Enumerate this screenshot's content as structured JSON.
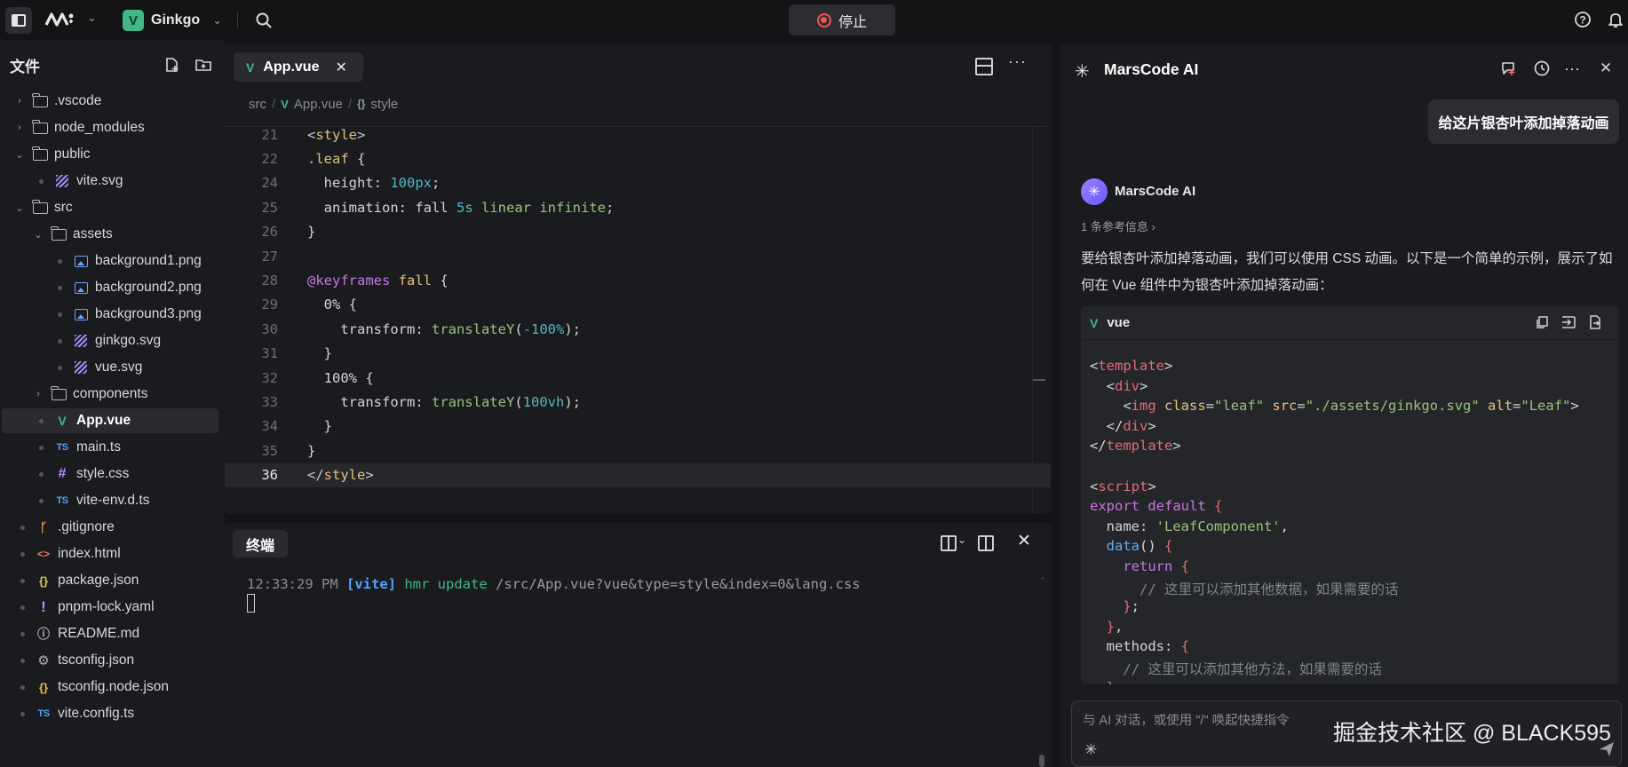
{
  "topbar": {
    "project_name": "Ginkgo",
    "stop_label": "停止"
  },
  "sidebar": {
    "title": "文件",
    "tree": [
      {
        "label": ".vscode",
        "kind": "folder",
        "depth": 0,
        "state": "collapsed"
      },
      {
        "label": "node_modules",
        "kind": "folder",
        "depth": 0,
        "state": "collapsed"
      },
      {
        "label": "public",
        "kind": "folder",
        "depth": 0,
        "state": "expanded"
      },
      {
        "label": "vite.svg",
        "kind": "svg",
        "depth": 1
      },
      {
        "label": "src",
        "kind": "folder",
        "depth": 0,
        "state": "expanded"
      },
      {
        "label": "assets",
        "kind": "folder",
        "depth": 1,
        "state": "expanded"
      },
      {
        "label": "background1.png",
        "kind": "image",
        "depth": 2
      },
      {
        "label": "background2.png",
        "kind": "image",
        "depth": 2
      },
      {
        "label": "background3.png",
        "kind": "image",
        "depth": 2
      },
      {
        "label": "ginkgo.svg",
        "kind": "svg",
        "depth": 2
      },
      {
        "label": "vue.svg",
        "kind": "svg",
        "depth": 2
      },
      {
        "label": "components",
        "kind": "folder",
        "depth": 1,
        "state": "collapsed"
      },
      {
        "label": "App.vue",
        "kind": "vue",
        "depth": 1,
        "active": true
      },
      {
        "label": "main.ts",
        "kind": "ts",
        "depth": 1
      },
      {
        "label": "style.css",
        "kind": "css",
        "depth": 1
      },
      {
        "label": "vite-env.d.ts",
        "kind": "ts",
        "depth": 1
      },
      {
        "label": ".gitignore",
        "kind": "git",
        "depth": 0
      },
      {
        "label": "index.html",
        "kind": "html",
        "depth": 0
      },
      {
        "label": "package.json",
        "kind": "json",
        "depth": 0
      },
      {
        "label": "pnpm-lock.yaml",
        "kind": "yaml",
        "depth": 0
      },
      {
        "label": "README.md",
        "kind": "info",
        "depth": 0
      },
      {
        "label": "tsconfig.json",
        "kind": "gear",
        "depth": 0
      },
      {
        "label": "tsconfig.node.json",
        "kind": "json",
        "depth": 0
      },
      {
        "label": "vite.config.ts",
        "kind": "ts",
        "depth": 0
      }
    ]
  },
  "editor": {
    "tab_label": "App.vue",
    "breadcrumb": [
      "src",
      "App.vue",
      "style"
    ],
    "current_line": "36",
    "lines": [
      {
        "n": "21",
        "html": "<span class='kw-punct'>&lt;</span><span class='kw-tag'>style</span><span class='kw-punct'>&gt;</span>"
      },
      {
        "n": "22",
        "html": "<span class='kw-tag'>.leaf</span> {"
      },
      {
        "n": "24",
        "html": "  height: <span class='kw-num'>100px</span>;"
      },
      {
        "n": "25",
        "html": "  animation: fall <span class='kw-num'>5s</span> <span class='kw-val'>linear</span> <span class='kw-val'>infinite</span>;"
      },
      {
        "n": "26",
        "html": "}"
      },
      {
        "n": "27",
        "html": ""
      },
      {
        "n": "28",
        "html": "<span class='kw-at'>@keyframes</span> <span class='kw-tag'>fall</span> {"
      },
      {
        "n": "29",
        "html": "  0% {"
      },
      {
        "n": "30",
        "html": "    transform: <span class='kw-val'>translateY</span>(<span class='kw-num'>-100%</span>);"
      },
      {
        "n": "31",
        "html": "  }"
      },
      {
        "n": "32",
        "html": "  100% {"
      },
      {
        "n": "33",
        "html": "    transform: <span class='kw-val'>translateY</span>(<span class='kw-num'>100vh</span>);"
      },
      {
        "n": "34",
        "html": "  }"
      },
      {
        "n": "35",
        "html": "}"
      },
      {
        "n": "36",
        "html": "<span class='kw-punct'>&lt;/</span><span class='kw-tag'>style</span><span class='kw-punct'>&gt;</span>"
      }
    ]
  },
  "terminal": {
    "tab_label": "终端",
    "time": "12:33:29 PM",
    "tag": "[vite]",
    "event": "hmr update",
    "path": "/src/App.vue?vue&type=style&index=0&lang.css"
  },
  "ai": {
    "title": "MarsCode AI",
    "user_message": "给这片银杏叶添加掉落动画",
    "assistant_name": "MarsCode AI",
    "refs": "1 条参考信息",
    "reply": "要给银杏叶添加掉落动画，我们可以使用 CSS 动画。以下是一个简单的示例，展示了如何在 Vue 组件中为银杏叶添加掉落动画：",
    "code_lang": "vue",
    "code_lines": [
      "<span class='t-punct'>&lt;</span><span class='t-tag'>template</span>&gt;",
      "  &lt;<span class='t-tag'>div</span>&gt;",
      "    &lt;<span class='t-tag'>img</span> <span class='t-attr'>class</span>=<span class='t-str'>\"leaf\"</span> <span class='t-attr'>src</span>=<span class='t-str'>\"./assets/ginkgo.svg\"</span> <span class='t-attr'>alt</span>=<span class='t-str'>\"Leaf\"</span>&gt;",
      "  &lt;/<span class='t-tag'>div</span>&gt;",
      "&lt;/<span class='t-tag'>template</span>&gt;",
      "",
      "&lt;<span class='t-tag'>script</span>&gt;",
      "<span class='t-kw'>export default</span> <span class='t-br'>{</span>",
      "  name: <span class='t-str'>'LeafComponent'</span>,",
      "  <span class='t-fn'>data</span>() <span class='t-br'>{</span>",
      "    <span class='t-kw'>return</span> <span class='t-br'>{</span>",
      "      <span class='t-com'>// 这里可以添加其他数据，如果需要的话</span>",
      "    <span class='t-br'>}</span>;",
      "  <span class='t-br'>}</span>,",
      "  methods: <span class='t-br'>{</span>",
      "    <span class='t-com'>// 这里可以添加其他方法，如果需要的话</span>",
      "  <span class='t-br'>}</span>"
    ],
    "input_placeholder": "与 AI 对话，或使用 \"/\" 唤起快捷指令"
  },
  "watermark": "掘金技术社区 @ BLACK595",
  "colors": {
    "accent_vue": "#41b883",
    "stop_red": "#f0525c",
    "ai_purple": "#9d7bff"
  }
}
